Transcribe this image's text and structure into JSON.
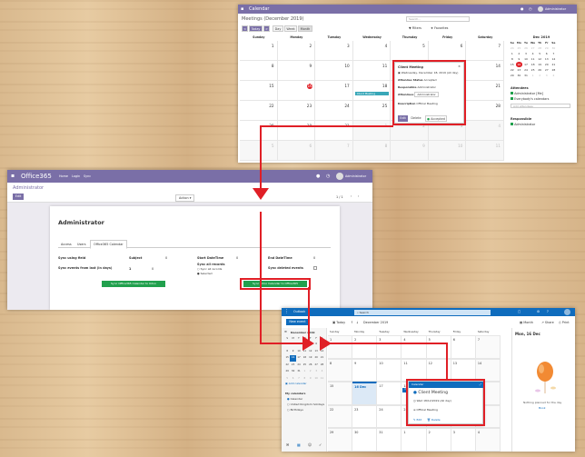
{
  "odoo_calendar": {
    "app_title": "Calendar",
    "breadcrumb": "Meetings (December 2019)",
    "user": "Administrator",
    "buttons": {
      "prev": "<",
      "today": "Today",
      "next": ">",
      "day": "Day",
      "week": "Week",
      "month": "Month"
    },
    "search_placeholder": "Search...",
    "filters_label": "Filters",
    "favorites_label": "Favorites",
    "weekdays": [
      "Sunday",
      "Monday",
      "Tuesday",
      "Wednesday",
      "Thursday",
      "Friday",
      "Saturday"
    ],
    "weeks": [
      [
        "1",
        "2",
        "3",
        "4",
        "5",
        "6",
        "7"
      ],
      [
        "8",
        "9",
        "10",
        "11",
        "12",
        "13",
        "14"
      ],
      [
        "15",
        "16",
        "17",
        "18",
        "19",
        "20",
        "21"
      ],
      [
        "22",
        "23",
        "24",
        "25",
        "26",
        "27",
        "28"
      ],
      [
        "29",
        "30",
        "31",
        "1",
        "2",
        "3",
        "4"
      ],
      [
        "5",
        "6",
        "7",
        "8",
        "9",
        "10",
        "11"
      ]
    ],
    "event_label": "Client Meeting",
    "popup": {
      "title": "Client Meeting",
      "date": "Wednesday, December 18, 2019 (All day)",
      "attendee_status_label": "Attendee Status",
      "attendee_status": "Accepted",
      "responsible_label": "Responsible",
      "responsible": "Administrator",
      "attendees_label": "Attendees",
      "attendee": "Administrator",
      "description_label": "Description",
      "description": "Official Meeting",
      "edit": "Edit",
      "delete": "Delete",
      "accepted": "Accepted"
    },
    "mini_month": "Dec 2019",
    "mini_days": [
      "Su",
      "Mo",
      "Tu",
      "We",
      "Th",
      "Fr",
      "Sa"
    ],
    "mini_weeks": [
      [
        "24",
        "25",
        "26",
        "27",
        "28",
        "29",
        "30"
      ],
      [
        "1",
        "2",
        "3",
        "4",
        "5",
        "6",
        "7"
      ],
      [
        "8",
        "9",
        "10",
        "11",
        "12",
        "13",
        "14"
      ],
      [
        "15",
        "16",
        "17",
        "18",
        "19",
        "20",
        "21"
      ],
      [
        "22",
        "23",
        "24",
        "25",
        "26",
        "27",
        "28"
      ],
      [
        "29",
        "30",
        "31",
        "1",
        "2",
        "3",
        "4"
      ]
    ],
    "attendees_header": "Attendees",
    "attendee_items": [
      "Administrator [Me]",
      "Everybody's calendars"
    ],
    "attendee_select": "Add attendees",
    "responsible_header": "Responsible",
    "responsible_items": [
      "Administrator"
    ]
  },
  "odoo_o365": {
    "app_title": "Office365",
    "menu": [
      "Home",
      "Login",
      "Sync"
    ],
    "user": "Administrator",
    "breadcrumb": "Administrator",
    "edit": "Edit",
    "action": "Action",
    "pager": "1 / 1",
    "record_title": "Administrator",
    "tabs": [
      "Access",
      "Users",
      "Office365 Calendar"
    ],
    "rows": [
      {
        "label": "Sync using field",
        "mid_label": "Subject",
        "mid_value": "0",
        "r_label": "Start DateTime",
        "r_value": "0",
        "f_label": "End DateTime",
        "f_value": "0"
      },
      {
        "label": "Sync events from last (in days)",
        "mid_value": "1",
        "mid_value2": "0",
        "r_label": "Sync all records",
        "r_option": "Sync all records",
        "r_option2": "Selected",
        "f_label": "Sync deleted events"
      }
    ],
    "btn_from": "Sync Office365 Calendar to Odoo",
    "btn_to": "Sync Odoo Calendar to Office365"
  },
  "outlook": {
    "app_title": "Outlook",
    "search_placeholder": "Search",
    "new_event": "New event",
    "today": "Today",
    "month_label": "December 2019",
    "view_month": "Month",
    "view_share": "Share",
    "view_print": "Print",
    "mini_month": "December 2019",
    "mini_days": [
      "S",
      "M",
      "T",
      "W",
      "T",
      "F",
      "S"
    ],
    "mini_weeks": [
      [
        "1",
        "2",
        "3",
        "4",
        "5",
        "6",
        "7"
      ],
      [
        "8",
        "9",
        "10",
        "11",
        "12",
        "13",
        "14"
      ],
      [
        "15",
        "16",
        "17",
        "18",
        "19",
        "20",
        "21"
      ],
      [
        "22",
        "23",
        "24",
        "25",
        "26",
        "27",
        "28"
      ],
      [
        "29",
        "30",
        "31",
        "1",
        "2",
        "3",
        "4"
      ],
      [
        "5",
        "6",
        "7",
        "8",
        "9",
        "10",
        "11"
      ]
    ],
    "add_calendar": "Add calendar",
    "my_calendars": "My calendars",
    "calendars": [
      "Calendar",
      "United Kingdom holidays",
      "Birthdays"
    ],
    "weekdays": [
      "Sunday",
      "Monday",
      "Tuesday",
      "Wednesday",
      "Thursday",
      "Friday",
      "Saturday"
    ],
    "weeks": [
      [
        "1",
        "2",
        "3",
        "4",
        "5",
        "6",
        "7"
      ],
      [
        "8",
        "9",
        "10",
        "11",
        "12",
        "13",
        "14"
      ],
      [
        "15",
        "16",
        "17",
        "18",
        "19",
        "20",
        "21"
      ],
      [
        "22",
        "23",
        "24",
        "25",
        "26",
        "27",
        "28"
      ],
      [
        "29",
        "30",
        "31",
        "1",
        "2",
        "3",
        "4"
      ]
    ],
    "event_label": "Client Meeting",
    "today_marker": "16 Dec",
    "popup": {
      "header": "Calendar",
      "title": "Client Meeting",
      "date": "Wed 18/12/2019 (All day)",
      "description": "Official Meeting",
      "edit": "Edit",
      "delete": "Delete"
    },
    "right_title": "Mon, 16 Dec",
    "empty_text": "Nothing planned for the day",
    "empty_link": "Book"
  },
  "colors": {
    "odoo_purple": "#7a6fa7",
    "outlook_blue": "#0f6cbd",
    "highlight_red": "#e01f26",
    "odoo_green": "#21a04d"
  }
}
